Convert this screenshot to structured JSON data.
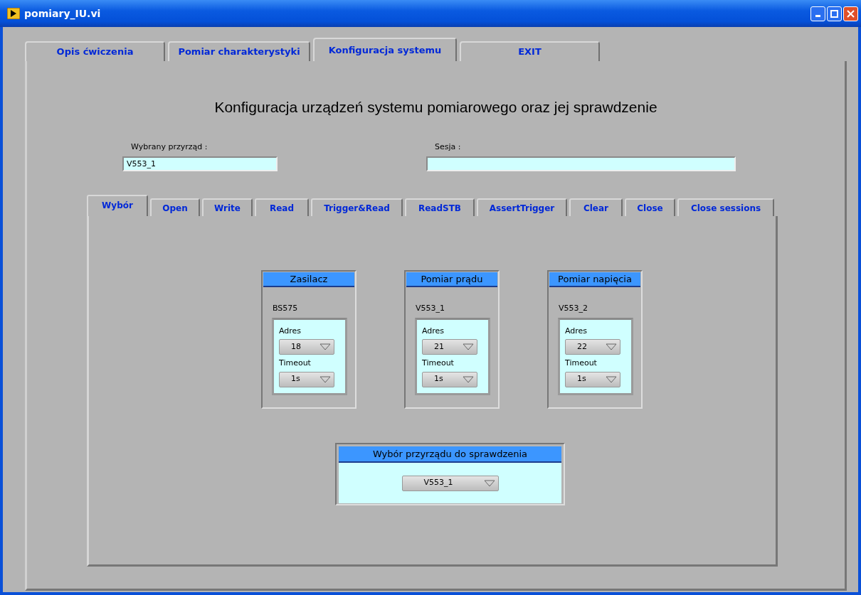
{
  "window": {
    "title": "pomiary_IU.vi"
  },
  "tabs": [
    {
      "label": "Opis ćwiczenia",
      "selected": false
    },
    {
      "label": "Pomiar charakterystyki",
      "selected": false
    },
    {
      "label": "Konfiguracja systemu",
      "selected": true
    },
    {
      "label": "EXIT",
      "selected": false
    }
  ],
  "heading": "Konfiguracja urządzeń systemu pomiarowego oraz jej sprawdzenie",
  "fields": [
    {
      "label": "Wybrany przyrząd :",
      "value": "V553_1"
    },
    {
      "label": "Sesja :"
    }
  ],
  "subtabs": [
    {
      "label": "Wybór",
      "selected": true
    },
    {
      "label": "Open",
      "selected": false
    },
    {
      "label": "Write",
      "selected": false
    },
    {
      "label": "Read",
      "selected": false
    },
    {
      "label": "Trigger&Read",
      "selected": false
    },
    {
      "label": "ReadSTB",
      "selected": false
    },
    {
      "label": "AssertTrigger",
      "selected": false
    },
    {
      "label": "Clear",
      "selected": false
    },
    {
      "label": "Close",
      "selected": false
    },
    {
      "label": "Close sessions",
      "selected": false
    }
  ],
  "groups": [
    {
      "title": "Zasilacz",
      "device": "BS575",
      "controls": [
        {
          "label": "Adres",
          "value": "18"
        },
        {
          "label": "Timeout",
          "value": "1s"
        }
      ]
    },
    {
      "title": "Pomiar prądu",
      "device": "V553_1",
      "controls": [
        {
          "label": "Adres",
          "value": "21"
        },
        {
          "label": "Timeout",
          "value": "1s"
        }
      ]
    },
    {
      "title": "Pomiar napięcia",
      "device": "V553_2",
      "controls": [
        {
          "label": "Adres",
          "value": "22"
        },
        {
          "label": "Timeout",
          "value": "1s"
        }
      ]
    }
  ],
  "check_selector": {
    "title": "Wybór przyrządu do sprawdzenia",
    "value": "V553_1"
  }
}
